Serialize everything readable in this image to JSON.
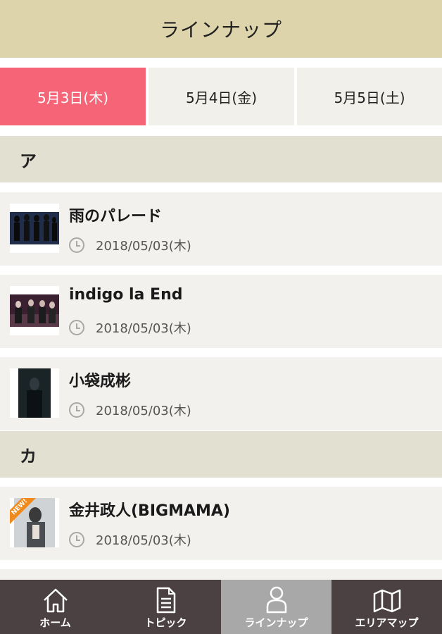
{
  "header": {
    "title": "ラインナップ"
  },
  "tabs": [
    {
      "label": "5月3日(木)",
      "active": true
    },
    {
      "label": "5月4日(金)",
      "active": false
    },
    {
      "label": "5月5日(土)",
      "active": false
    }
  ],
  "sections": [
    {
      "heading": "ア",
      "artists": [
        {
          "name": "雨のパレード",
          "date": "2018/05/03(木)"
        },
        {
          "name": "indigo la End",
          "date": "2018/05/03(木)"
        },
        {
          "name": "小袋成彬",
          "date": "2018/05/03(木)"
        }
      ]
    },
    {
      "heading": "カ",
      "artists": [
        {
          "name": "金井政人(BIGMAMA)",
          "date": "2018/05/03(木)",
          "badge": "NEW!"
        }
      ]
    }
  ],
  "bottom_nav": [
    {
      "label": "ホーム",
      "icon": "home-icon",
      "active": false
    },
    {
      "label": "トピック",
      "icon": "document-icon",
      "active": false
    },
    {
      "label": "ラインナップ",
      "icon": "person-icon",
      "active": true
    },
    {
      "label": "エリアマップ",
      "icon": "map-icon",
      "active": false
    }
  ],
  "colors": {
    "header_bg": "#ded4ac",
    "active_tab": "#f56577",
    "section_bg": "#e2e0d0",
    "nav_bg": "#4b4042",
    "nav_active": "#a9a8a8",
    "badge": "#f08a1c"
  }
}
